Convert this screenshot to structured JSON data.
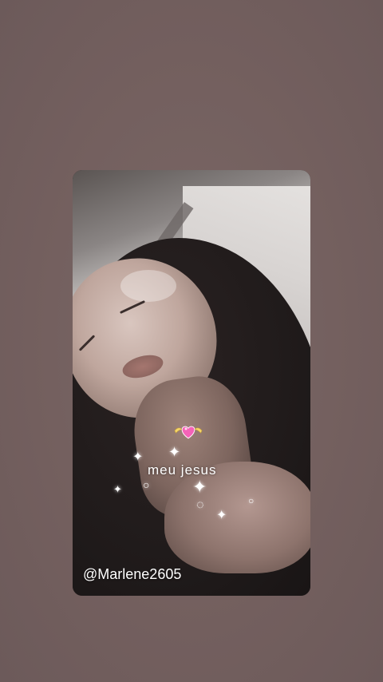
{
  "story": {
    "caption": "meu jesus",
    "username": "@Marlene2605"
  },
  "stickers": {
    "heart_icon": "heart-with-wings-icon",
    "sparkle_glyph": "✦"
  }
}
